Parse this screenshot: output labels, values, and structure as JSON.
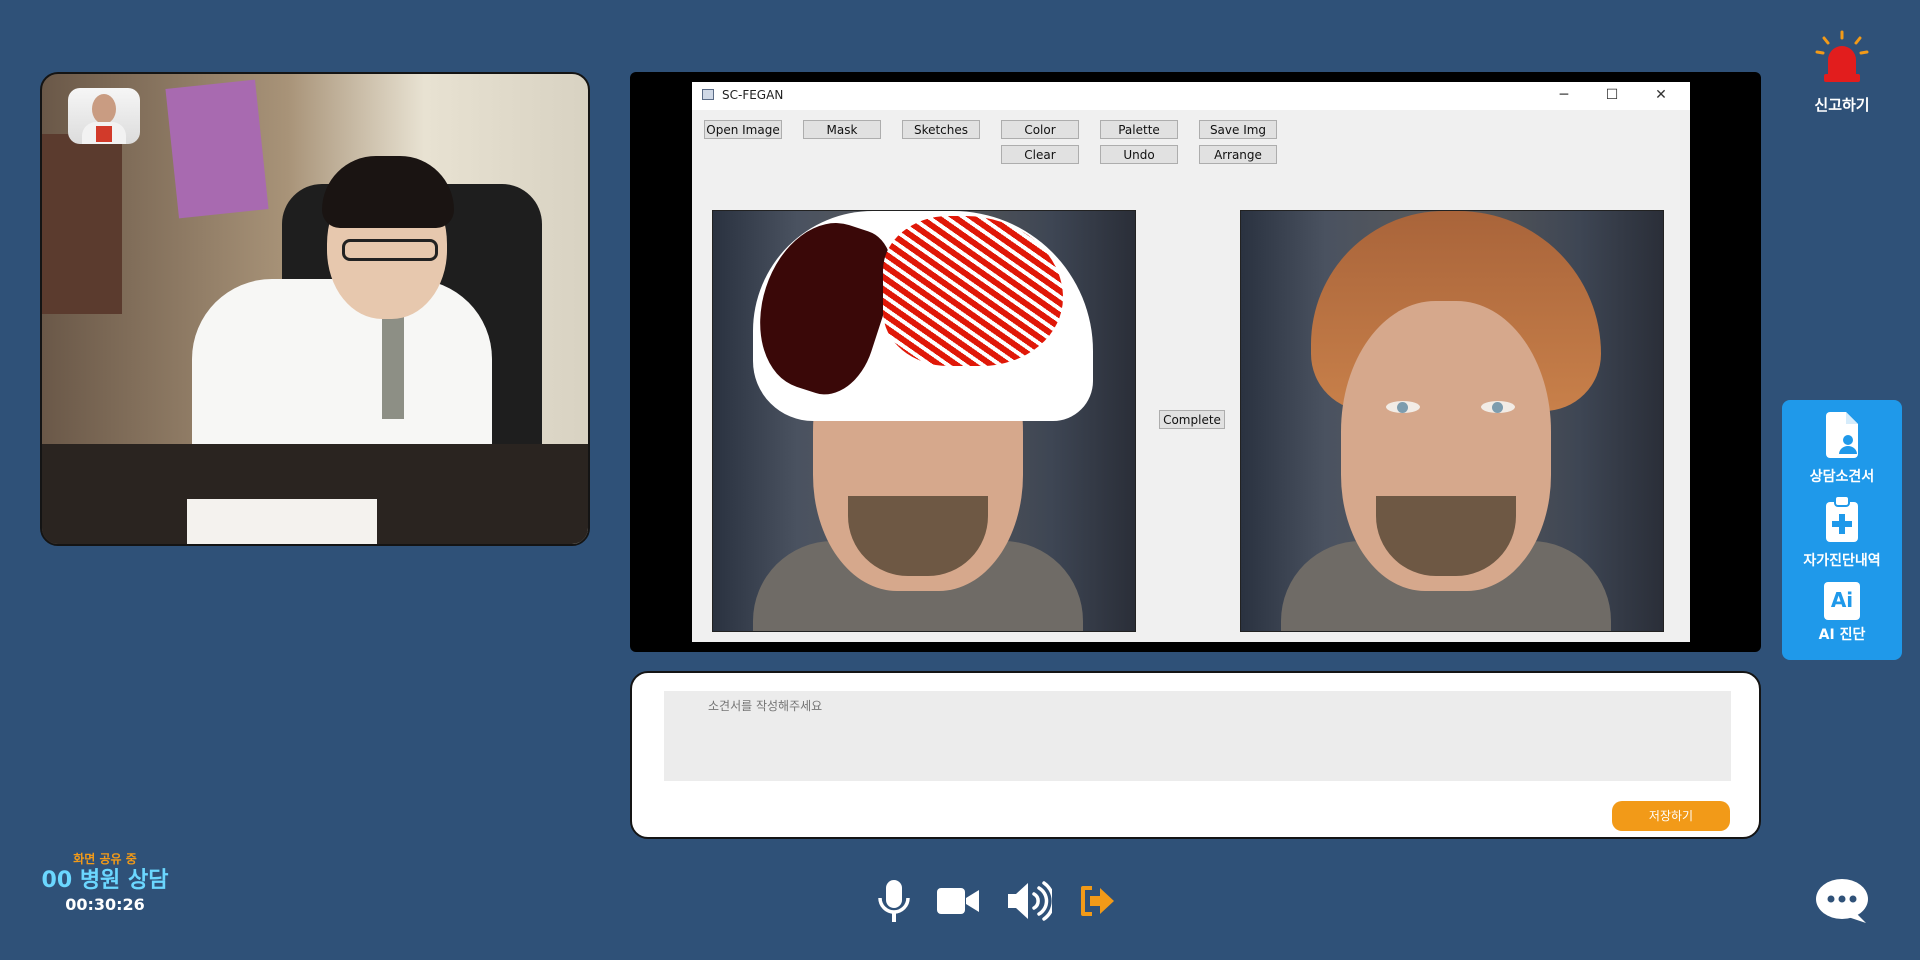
{
  "self_video": {},
  "shared_app": {
    "title": "SC-FEGAN",
    "window_controls": [
      "─",
      "☐",
      "✕"
    ],
    "buttons_row1": [
      "Open Image",
      "Mask",
      "Sketches",
      "Color",
      "Palette",
      "Save Img"
    ],
    "buttons_row2": [
      "Clear",
      "Undo",
      "Arrange"
    ],
    "complete_label": "Complete"
  },
  "notes": {
    "placeholder": "소견서를 작성해주세요",
    "save_label": "저장하기"
  },
  "report": {
    "label": "신고하기"
  },
  "side_menu": {
    "items": [
      {
        "label": "상담소견서",
        "icon": "document-user-icon"
      },
      {
        "label": "자가진단내역",
        "icon": "clipboard-plus-icon"
      },
      {
        "label": "AI 진단",
        "icon": "ai-icon",
        "icon_text": "Ai"
      }
    ]
  },
  "status": {
    "sharing": "화면 공유 중",
    "hospital": "00 병원 상담",
    "elapsed": "00:30:26"
  },
  "controls": [
    "microphone-icon",
    "camera-icon",
    "speaker-icon",
    "exit-icon"
  ],
  "colors": {
    "background": "#2f5178",
    "accent": "#f29a18",
    "side_panel": "#1f99ea",
    "status_name": "#6bd7ff"
  }
}
